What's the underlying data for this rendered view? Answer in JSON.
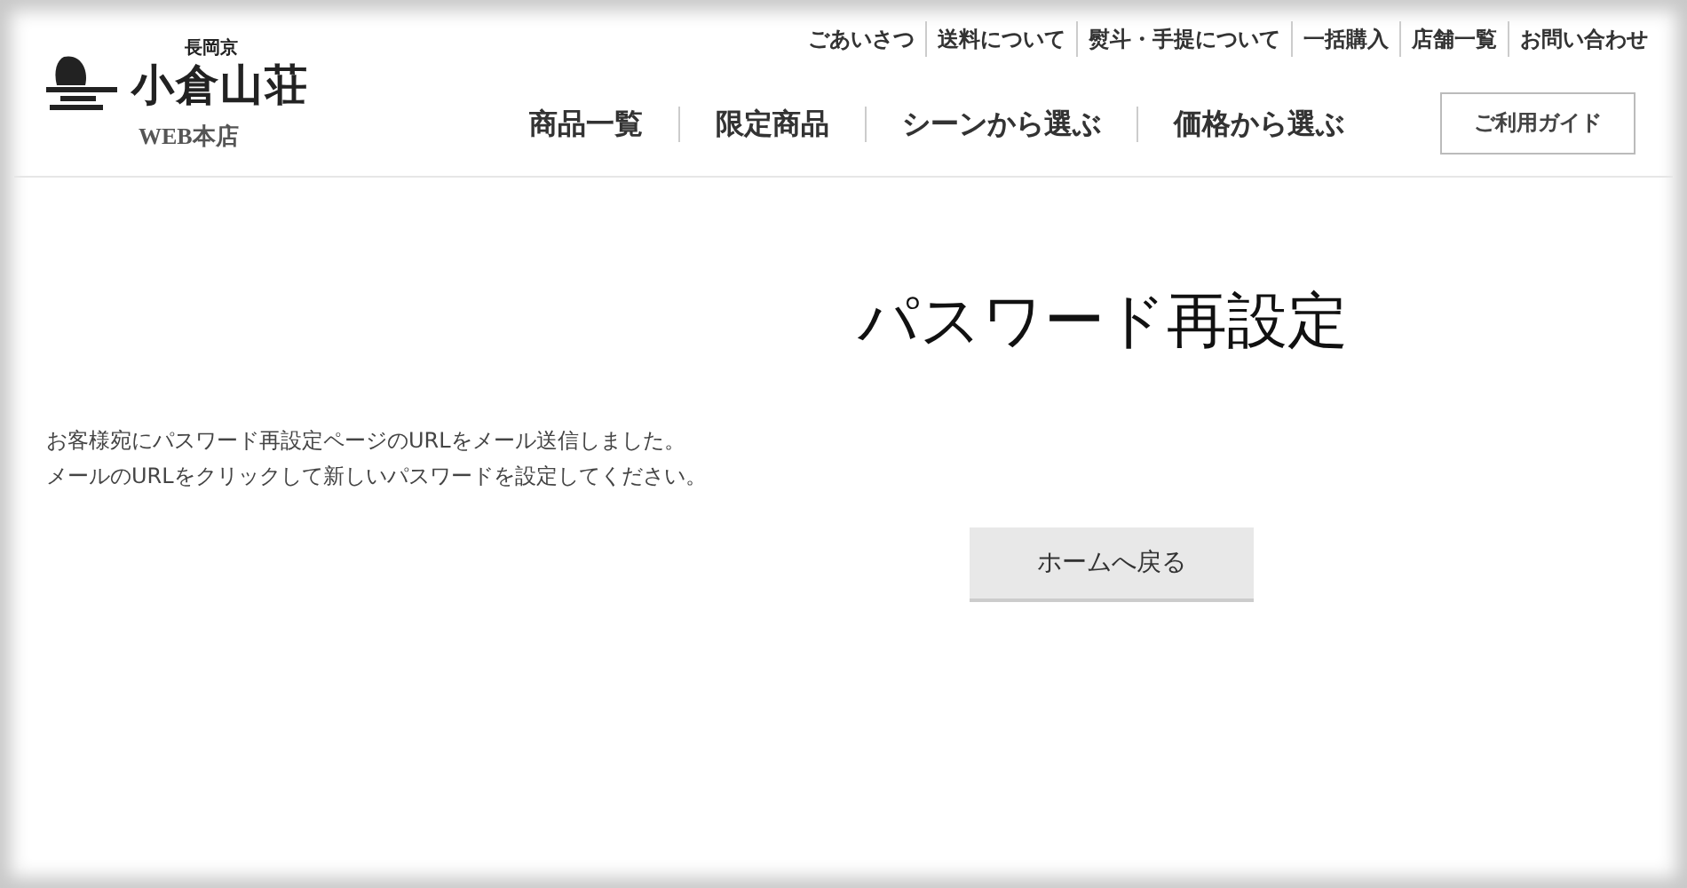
{
  "logo": {
    "subtitle": "長岡京",
    "name": "小倉山荘",
    "store": "WEB本店"
  },
  "top_links": [
    "ごあいさつ",
    "送料について",
    "熨斗・手提について",
    "一括購入",
    "店舗一覧",
    "お問い合わせ"
  ],
  "main_nav": [
    "商品一覧",
    "限定商品",
    "シーンから選ぶ",
    "価格から選ぶ"
  ],
  "guide_button": "ご利用ガイド",
  "page_title": "パスワード再設定",
  "message": [
    "お客様宛にパスワード再設定ページのURLをメール送信しました。",
    "メールのURLをクリックして新しいパスワードを設定してください。"
  ],
  "home_button": "ホームへ戻る"
}
